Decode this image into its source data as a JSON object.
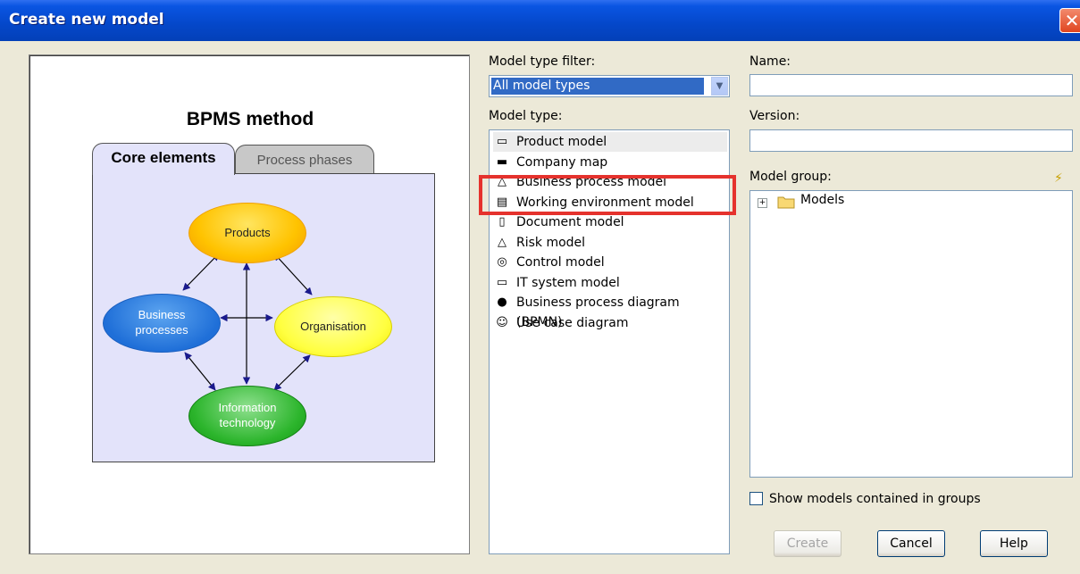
{
  "window": {
    "title": "Create new model",
    "close_glyph": "✕"
  },
  "preview": {
    "heading": "BPMS method",
    "tab_active": "Core elements",
    "tab_inactive": "Process phases",
    "nodes": {
      "products": "Products",
      "business_1": "Business",
      "business_2": "processes",
      "organisation": "Organisation",
      "it_1": "Information",
      "it_2": "technology"
    }
  },
  "filter": {
    "label": "Model type filter:",
    "value": "All model types",
    "arrow": "▼"
  },
  "model_type": {
    "label": "Model type:",
    "items": [
      {
        "label": "Product model",
        "icon": "product-model-icon",
        "glyph": "▭"
      },
      {
        "label": "Company map",
        "icon": "company-map-icon",
        "glyph": "▬"
      },
      {
        "label": "Business process model",
        "icon": "business-process-icon",
        "glyph": "△"
      },
      {
        "label": "Working environment model",
        "icon": "working-environment-icon",
        "glyph": "▤"
      },
      {
        "label": "Document model",
        "icon": "document-model-icon",
        "glyph": "▯"
      },
      {
        "label": "Risk model",
        "icon": "risk-model-icon",
        "glyph": "△"
      },
      {
        "label": "Control model",
        "icon": "control-model-icon",
        "glyph": "◎"
      },
      {
        "label": "IT system model",
        "icon": "it-system-icon",
        "glyph": "▭"
      },
      {
        "label": "Business process diagram (BPMN)",
        "icon": "bpmn-icon",
        "glyph": "●"
      },
      {
        "label": "Use case diagram",
        "icon": "use-case-icon",
        "glyph": "☺"
      }
    ],
    "selected_index": 0
  },
  "name": {
    "label": "Name:",
    "value": ""
  },
  "version": {
    "label": "Version:",
    "value": ""
  },
  "model_group": {
    "label": "Model group:",
    "tree_root": "Models",
    "expand_glyph": "+",
    "link_glyph": "⚡"
  },
  "show_models": {
    "label": "Show models contained in groups",
    "checked": false
  },
  "buttons": {
    "create": "Create",
    "cancel": "Cancel",
    "help": "Help"
  },
  "colors": {
    "title_bar": "#0a55e2",
    "highlight_box": "#e5322d",
    "selection": "#316ac5"
  }
}
